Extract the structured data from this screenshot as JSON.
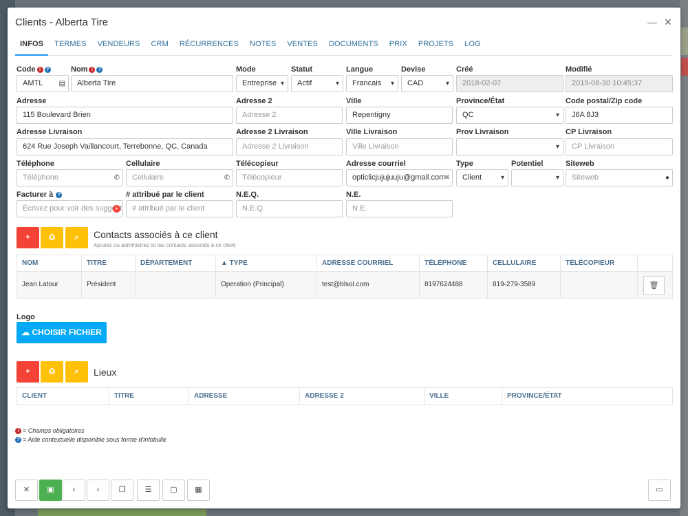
{
  "window": {
    "title": "Clients - Alberta Tire",
    "minimize": "—",
    "close": "✕"
  },
  "tabs": [
    "INFOS",
    "TERMES",
    "VENDEURS",
    "CRM",
    "RÉCURRENCES",
    "NOTES",
    "VENTES",
    "DOCUMENTS",
    "PRIX",
    "PROJETS",
    "LOG"
  ],
  "form": {
    "code": {
      "label": "Code",
      "value": "AMTL"
    },
    "nom": {
      "label": "Nom",
      "value": "Alberta Tire"
    },
    "mode": {
      "label": "Mode",
      "value": "Entreprise"
    },
    "statut": {
      "label": "Statut",
      "value": "Actif"
    },
    "langue": {
      "label": "Langue",
      "value": "Francais"
    },
    "devise": {
      "label": "Devise",
      "value": "CAD"
    },
    "cree": {
      "label": "Créé",
      "value": "2018-02-07"
    },
    "modifie": {
      "label": "Modifié",
      "value": "2019-08-30 10:45:37"
    },
    "adresse": {
      "label": "Adresse",
      "value": "115 Boulevard Brien"
    },
    "adresse2": {
      "label": "Adresse 2",
      "placeholder": "Adresse 2"
    },
    "ville": {
      "label": "Ville",
      "value": "Repentigny"
    },
    "province": {
      "label": "Province/État",
      "value": "QC"
    },
    "code_postal": {
      "label": "Code postal/Zip code",
      "value": "J6A 8J3"
    },
    "adresse_livraison": {
      "label": "Adresse Livraison",
      "value": "624 Rue Joseph Vaillancourt, Terrebonne, QC, Canada"
    },
    "adresse2_livraison": {
      "label": "Adresse 2 Livraison",
      "placeholder": "Adresse 2 Livraison"
    },
    "ville_livraison": {
      "label": "Ville Livraison",
      "placeholder": "Ville Livraison"
    },
    "prov_livraison": {
      "label": "Prov Livraison",
      "value": ""
    },
    "cp_livraison": {
      "label": "CP Livraison",
      "placeholder": "CP Livraison"
    },
    "telephone": {
      "label": "Téléphone",
      "placeholder": "Téléphone"
    },
    "cellulaire": {
      "label": "Cellulaire",
      "placeholder": "Cellulaire"
    },
    "telecopieur": {
      "label": "Télécopieur",
      "placeholder": "Télécopieur"
    },
    "courriel": {
      "label": "Adresse courriel",
      "value": "opticlicjujujuuju@gmail.com"
    },
    "type": {
      "label": "Type",
      "value": "Client"
    },
    "potentiel": {
      "label": "Potentiel",
      "value": ""
    },
    "siteweb": {
      "label": "Siteweb",
      "placeholder": "Siteweb"
    },
    "facturer": {
      "label": "Facturer à",
      "placeholder": "Écrivez pour voir des suggestions"
    },
    "attribue": {
      "label": "# attribué par le client",
      "placeholder": "# attribué par le client"
    },
    "neq": {
      "label": "N.E.Q.",
      "placeholder": "N.E.Q."
    },
    "ne": {
      "label": "N.E.",
      "placeholder": "N.E."
    }
  },
  "contacts": {
    "title": "Contacts associés à ce client",
    "subtitle": "Ajoutez ou administrez ici les contacts associés à ce client",
    "columns": [
      "NOM",
      "TITRE",
      "DÉPARTEMENT",
      "▲ TYPE",
      "ADRESSE COURRIEL",
      "TÉLÉPHONE",
      "CELLULAIRE",
      "TÉLÉCOPIEUR",
      ""
    ],
    "rows": [
      [
        "Jean Latour",
        "Président",
        "",
        "Operation (Principal)",
        "test@blsol.com",
        "8197624488",
        "819-279-3589",
        ""
      ]
    ]
  },
  "logo": {
    "label": "Logo",
    "button": "CHOISIR FICHIER"
  },
  "lieux": {
    "title": "Lieux",
    "columns": [
      "CLIENT",
      "TITRE",
      "ADRESSE",
      "ADRESSE 2",
      "VILLE",
      "PROVINCE/ÉTAT"
    ]
  },
  "legend": {
    "required": "= Champs obligatoires",
    "help": "= Aide contextuelle disponible sous forme d'infobulle"
  },
  "icons": {
    "add": "+",
    "print": "⎙",
    "search": "⌕",
    "close": "✕",
    "save": "▣",
    "prev": "‹",
    "next": "›",
    "copy": "❐",
    "list": "☰",
    "doc": "▢",
    "calendar": "▦",
    "camera": "▭",
    "trash": "🗑",
    "phone": "✆",
    "mail": "✉",
    "globe": "●",
    "id_card": "▤",
    "upload": "☁"
  },
  "colors": {
    "accent": "#2196f3",
    "danger": "#f44336",
    "warning": "#ffc107",
    "success": "#4caf50",
    "info": "#03a9f4"
  }
}
